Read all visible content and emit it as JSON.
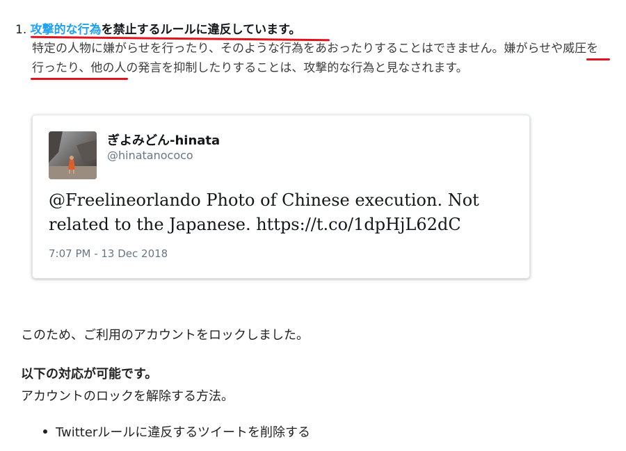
{
  "rule": {
    "number": "1.",
    "link_text": "攻撃的な行為",
    "rest_text": "を禁止するルールに違反しています。",
    "description": "特定の人物に嫌がらせを行ったり、そのような行為をあおったりすることはできません。嫌がらせや威圧を行ったり、他の人の発言を抑制したりすることは、攻撃的な行為と見なされます。"
  },
  "tweet": {
    "display_name": "ぎよみどん-hinata",
    "handle": "@hinatanococo",
    "text": "@Freelineorlando Photo of Chinese execution. Not related to the Japanese. https://t.co/1dpHjL62dC",
    "timestamp": "7:07 PM - 13 Dec 2018"
  },
  "lock_message": "このため、ご利用のアカウントをロックしました。",
  "options_heading": "以下の対応が可能です。",
  "unlock_method": "アカウントのロックを解除する方法。",
  "bullets": [
    "Twitterルールに違反するツイートを削除する"
  ],
  "colors": {
    "link": "#1da1f2",
    "annotation": "#e0141e",
    "secondary_text": "#657786"
  }
}
